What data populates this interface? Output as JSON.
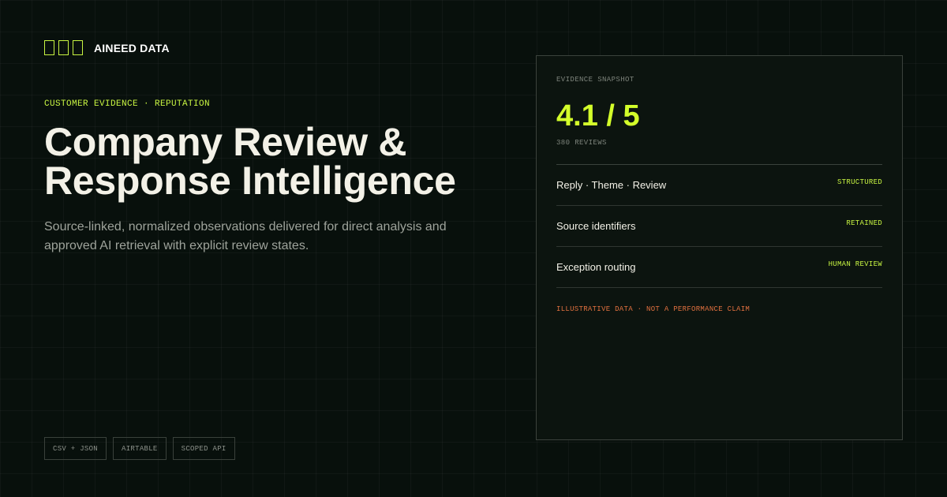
{
  "brand": {
    "name": "AINEED DATA",
    "accent": "#c8f542",
    "logo_icon": "three-square-logo-icon"
  },
  "hero": {
    "eyebrow": "CUSTOMER EVIDENCE · REPUTATION",
    "title_line1": "Company Review &",
    "title_line2": "Response Intelligence",
    "subtitle": "Source-linked, normalized observations delivered for direct analysis and approved AI retrieval with explicit review states."
  },
  "tags": [
    {
      "label": "CSV + JSON"
    },
    {
      "label": "AIRTABLE"
    },
    {
      "label": "SCOPED API"
    }
  ],
  "panel": {
    "kicker": "EVIDENCE SNAPSHOT",
    "score": "4.1 / 5",
    "score_color": "#d4ff2a",
    "reviews": "380 REVIEWS",
    "rows": [
      {
        "label": "Reply · Theme · Review",
        "status": "STRUCTURED"
      },
      {
        "label": "Source identifiers",
        "status": "RETAINED"
      },
      {
        "label": "Exception routing",
        "status": "HUMAN REVIEW"
      }
    ],
    "disclaimer": "ILLUSTRATIVE DATA · NOT A PERFORMANCE CLAIM",
    "disclaimer_color": "#e0703f"
  },
  "colors": {
    "background": "#08100c",
    "panel_background": "#0c140f",
    "text": "#f3f1e7",
    "muted": "#9ea39b"
  }
}
